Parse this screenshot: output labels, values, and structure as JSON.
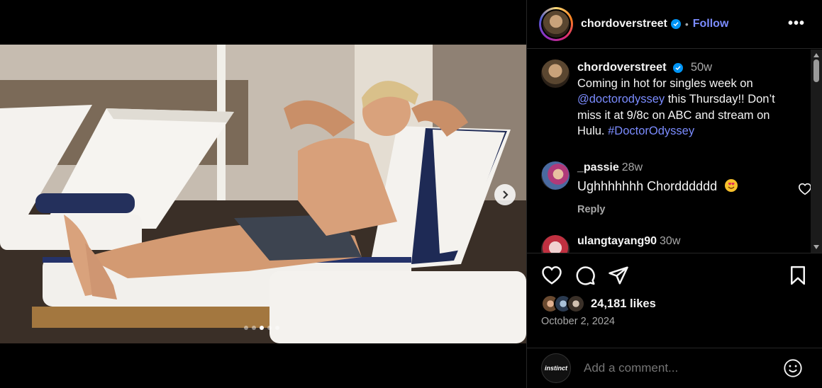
{
  "post": {
    "username": "chordoverstreet",
    "follow_label": "Follow",
    "separator": "•",
    "more_label": "•••"
  },
  "caption": {
    "username": "chordoverstreet",
    "time": "50w",
    "text_1": "Coming in hot for singles week on ",
    "mention": "@doctorodyssey",
    "text_2": " this Thursday!! Don’t miss it at 9/8c on ABC and stream on Hulu. ",
    "hashtag": "#DoctorOdyssey"
  },
  "comments": [
    {
      "username": "_passie",
      "time": "28w",
      "text": "Ughhhhhhh Chordddddd",
      "reply_label": "Reply"
    },
    {
      "username": "ulangtayang90",
      "time": "30w"
    }
  ],
  "stats": {
    "likes": "24,181 likes",
    "date": "October 2, 2024"
  },
  "composer": {
    "avatar_text": "instinct",
    "placeholder": "Add a comment..."
  },
  "carousel": {
    "count": 5,
    "active": 3
  },
  "colors": {
    "accent_link": "#7b8cff",
    "verified": "#0095f6",
    "background": "#000000"
  }
}
